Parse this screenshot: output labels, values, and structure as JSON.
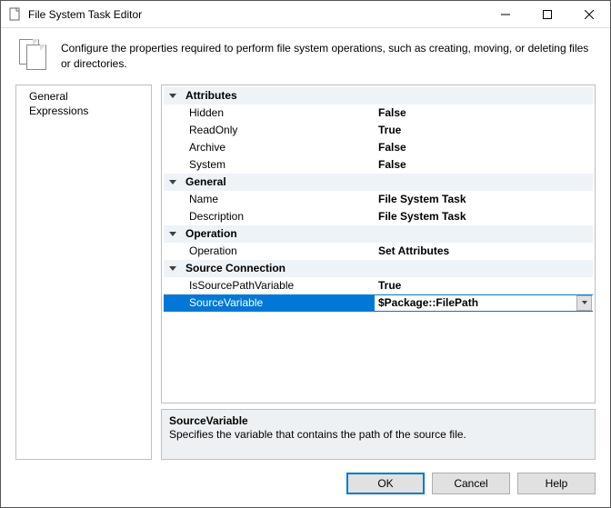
{
  "window": {
    "title": "File System Task Editor"
  },
  "header": {
    "text": "Configure the properties required to perform file system operations, such as creating, moving, or deleting files or directories."
  },
  "nav": {
    "items": [
      {
        "label": "General"
      },
      {
        "label": "Expressions"
      }
    ]
  },
  "grid": {
    "categories": [
      {
        "name": "Attributes",
        "props": [
          {
            "name": "Hidden",
            "value": "False"
          },
          {
            "name": "ReadOnly",
            "value": "True"
          },
          {
            "name": "Archive",
            "value": "False"
          },
          {
            "name": "System",
            "value": "False"
          }
        ]
      },
      {
        "name": "General",
        "props": [
          {
            "name": "Name",
            "value": "File System Task"
          },
          {
            "name": "Description",
            "value": "File System Task"
          }
        ]
      },
      {
        "name": "Operation",
        "props": [
          {
            "name": "Operation",
            "value": "Set Attributes"
          }
        ]
      },
      {
        "name": "Source Connection",
        "props": [
          {
            "name": "IsSourcePathVariable",
            "value": "True"
          },
          {
            "name": "SourceVariable",
            "value": "$Package::FilePath",
            "selected": true,
            "dropdown": true
          }
        ]
      }
    ]
  },
  "desc": {
    "title": "SourceVariable",
    "text": "Specifies the variable that contains the path of the source file."
  },
  "buttons": {
    "ok": "OK",
    "cancel": "Cancel",
    "help": "Help"
  }
}
